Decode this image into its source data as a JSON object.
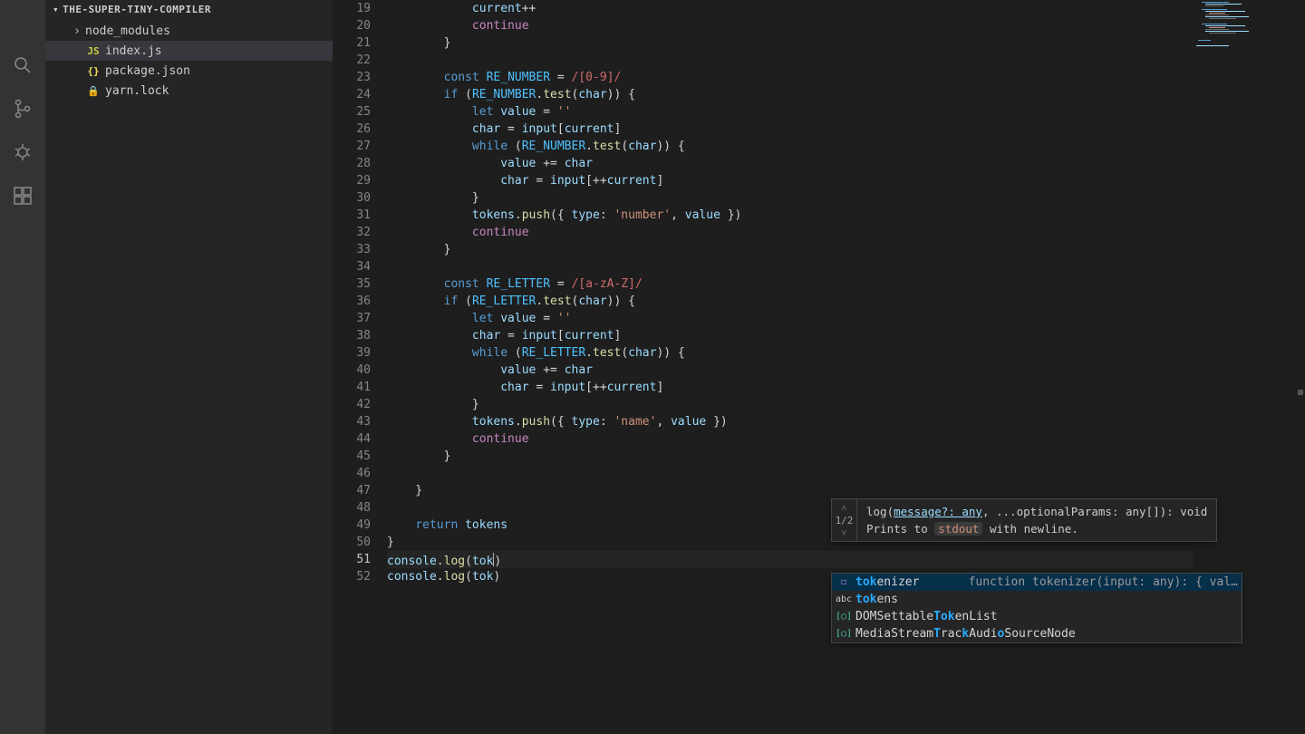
{
  "sidebar": {
    "project_name": "THE-SUPER-TINY-COMPILER",
    "items": [
      {
        "label": "node_modules",
        "type": "folder"
      },
      {
        "label": "index.js",
        "type": "js",
        "selected": true
      },
      {
        "label": "package.json",
        "type": "json"
      },
      {
        "label": "yarn.lock",
        "type": "lock"
      }
    ]
  },
  "editor": {
    "first_line_no": 19,
    "current_line_no": 51,
    "lines": [
      "            current++",
      "            continue",
      "        }",
      "",
      "        const RE_NUMBER = /[0-9]/",
      "        if (RE_NUMBER.test(char)) {",
      "            let value = ''",
      "            char = input[current]",
      "            while (RE_NUMBER.test(char)) {",
      "                value += char",
      "                char = input[++current]",
      "            }",
      "            tokens.push({ type: 'number', value })",
      "            continue",
      "        }",
      "",
      "        const RE_LETTER = /[a-zA-Z]/",
      "        if (RE_LETTER.test(char)) {",
      "            let value = ''",
      "            char = input[current]",
      "            while (RE_LETTER.test(char)) {",
      "                value += char",
      "                char = input[++current]",
      "            }",
      "            tokens.push({ type: 'name', value })",
      "            continue",
      "        }",
      "",
      "    }",
      "",
      "    return tokens",
      "}",
      "",
      "console.log(tok)"
    ]
  },
  "signature_help": {
    "pager": "1/2",
    "signature_pre": "log(",
    "active_param": "message?: any",
    "signature_post": ", ...optionalParams: any[]): void",
    "doc_pre": "Prints to ",
    "doc_code": "stdout",
    "doc_post": " with newline."
  },
  "suggest": {
    "items": [
      {
        "icon": "func",
        "pre": "tok",
        "rest": "enizer",
        "detail": "function tokenizer(input: any): { val…",
        "selected": true
      },
      {
        "icon": "abc",
        "pre": "tok",
        "rest": "ens",
        "detail": ""
      },
      {
        "icon": "intf",
        "pre_plain": "DOMSettable",
        "hl": "Tok",
        "rest": "enList",
        "detail": ""
      },
      {
        "icon": "intf",
        "pre_plain": "MediaStream",
        "hl": "T",
        "mid1": "rac",
        "hl2": "k",
        "mid2": "Audi",
        "hl3": "o",
        "rest": "SourceNode",
        "detail": ""
      }
    ]
  }
}
